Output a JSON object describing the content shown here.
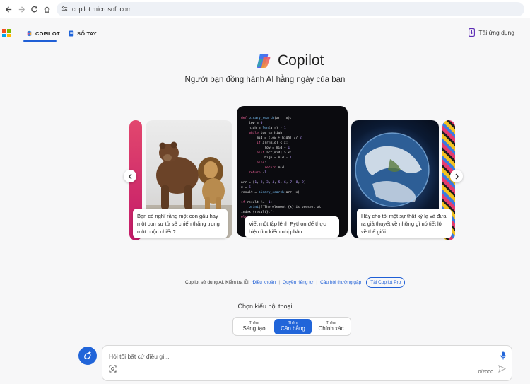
{
  "browser": {
    "url": "copilot.microsoft.com"
  },
  "header": {
    "tabs": [
      {
        "label": "COPILOT",
        "active": true
      },
      {
        "label": "SỔ TAY",
        "active": false
      }
    ],
    "download_label": "Tải ứng dụng"
  },
  "hero": {
    "app_name": "Copilot",
    "subtitle": "Người bạn đồng hành AI hằng ngày của bạn"
  },
  "carousel": {
    "cards": [
      {
        "caption": "Bạn có nghĩ rằng một con gấu hay một con sư tử sẽ chiến thắng trong một cuộc chiến?"
      },
      {
        "caption": "Viết một tập lệnh Python để thực hiện tìm kiếm nhị phân"
      },
      {
        "caption": "Hãy cho tôi một sự thật kỳ lạ và đưa ra giả thuyết về những gì nó tiết lộ về thế giới"
      }
    ],
    "code_lines": [
      "def binary_search(arr, x):",
      "    low = 0",
      "    high = len(arr) - 1",
      "    while low <= high:",
      "        mid = (low + high) // 2",
      "        if arr[mid] < x:",
      "            low = mid + 1",
      "        elif arr[mid] > x:",
      "            high = mid - 1",
      "        else:",
      "            return mid",
      "    return -1",
      "",
      "arr = [1, 2, 3, 4, 5, 6, 7, 8, 9]",
      "x = 5",
      "result = binary_search(arr, x)",
      "",
      "if result != -1:",
      "    print(f\"The element {x} is present at",
      "index {result}.\")",
      "else:"
    ]
  },
  "terms": {
    "text": "Copilot sử dụng AI. Kiểm tra lỗi.",
    "links": [
      "Điều khoản",
      "Quyền riêng tư",
      "Câu hỏi thường gặp"
    ],
    "pro_button": "Tải Copilot Pro"
  },
  "conversation_style": {
    "label": "Chọn kiểu hội thoại",
    "options": [
      {
        "prefix": "Thêm",
        "name": "Sáng tạo",
        "selected": false
      },
      {
        "prefix": "Thêm",
        "name": "Cân bằng",
        "selected": true
      },
      {
        "prefix": "Thêm",
        "name": "Chính xác",
        "selected": false
      }
    ]
  },
  "composer": {
    "placeholder": "Hỏi tôi bất cứ điều gì...",
    "counter": "0/2000"
  },
  "colors": {
    "accent": "#2165d9",
    "background": "#f7f7f8"
  }
}
